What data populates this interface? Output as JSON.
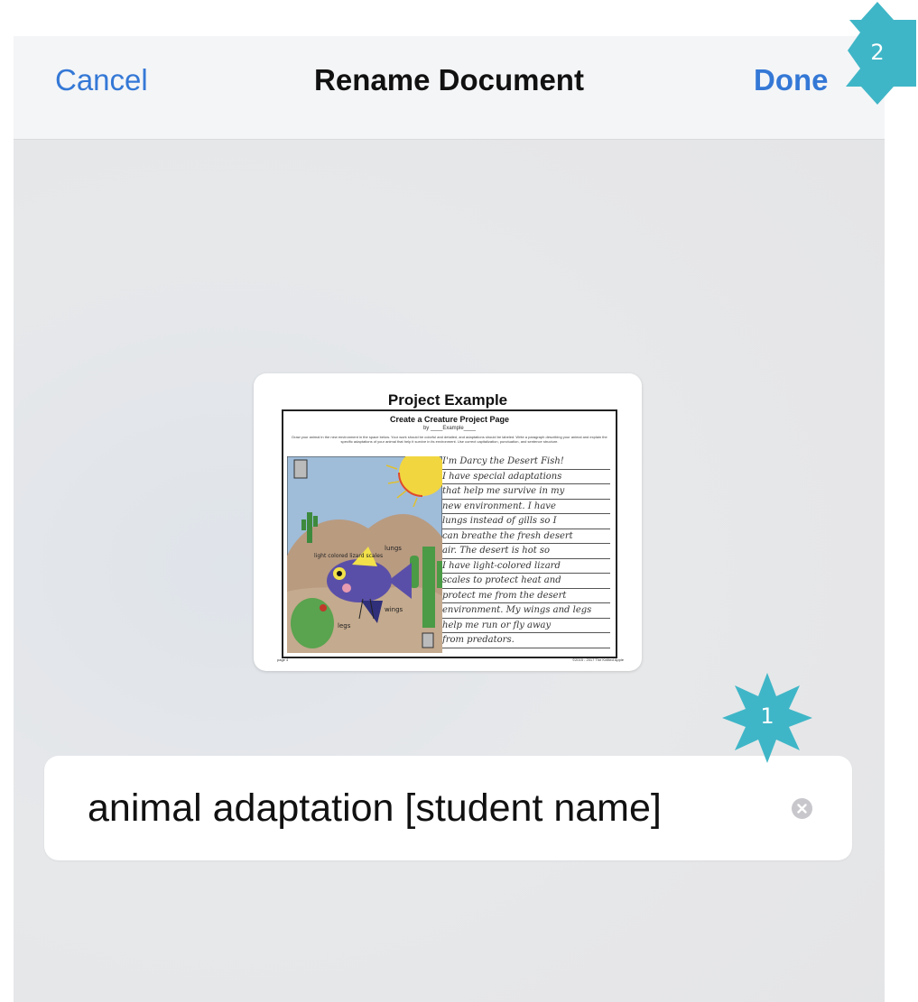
{
  "navbar": {
    "cancel_label": "Cancel",
    "title": "Rename Document",
    "done_label": "Done"
  },
  "document_preview": {
    "title": "Project Example",
    "subtitle": "Create a Creature Project Page",
    "byline": "by ____Example____",
    "instructions": "Draw your animal in the new environment in the space below. Your work should be colorful and detailed, and adaptations should be labeled. Write a paragraph describing your animal and explain the specific adaptations of your animal that help it survive in its environment. Use correct capitalization, punctuation, and sentence structure.",
    "drawing_labels": {
      "label1": "light colored lizard scales",
      "label2": "lungs",
      "label3": "wings",
      "label4": "legs"
    },
    "paragraph_lines": [
      "I'm Darcy the Desert Fish!",
      "I have special adaptations",
      "that help me survive in my",
      "new environment. I have",
      "lungs instead of gills so I",
      "can breathe the fresh desert",
      "air. The desert is hot so",
      "I have light-colored lizard",
      "scales to protect heat and",
      "protect me from the desert",
      "environment. My wings and legs",
      "help me run or fly away",
      "from predators."
    ],
    "footer_left": "page 4",
    "footer_right": "©2015 - 2017 The Knitted Apple"
  },
  "name_field": {
    "value": "animal adaptation [student name]"
  },
  "callouts": [
    {
      "number": "1",
      "color": "#3fb6c7"
    },
    {
      "number": "2",
      "color": "#3fb6c7"
    }
  ],
  "colors": {
    "accent": "#3478d6",
    "callout": "#3fb6c7"
  }
}
